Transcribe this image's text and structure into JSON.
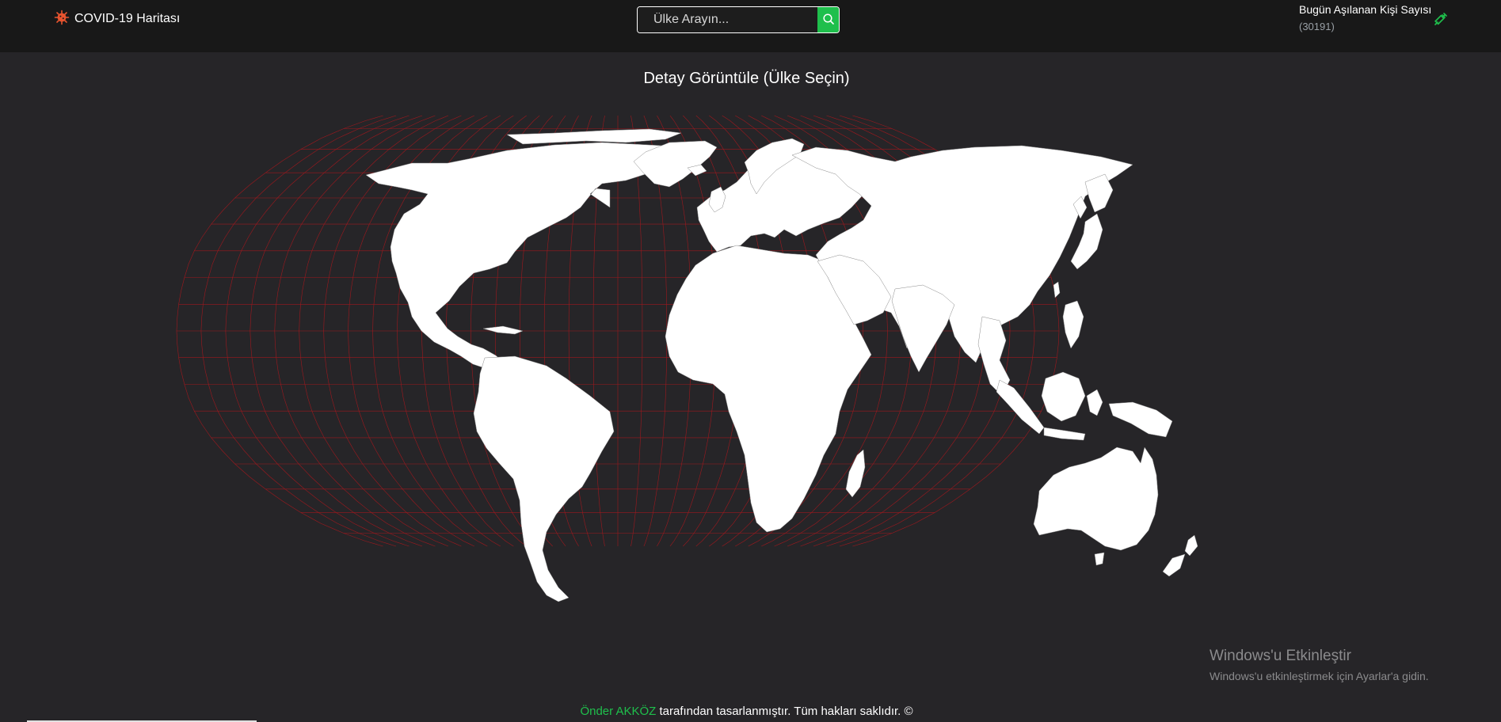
{
  "header": {
    "brand_label": "COVID-19 Haritası",
    "brand_icon": "virus-icon",
    "search_placeholder": "Ülke Arayın...",
    "search_icon": "search-icon",
    "vaccination_title": "Bugün Aşılanan Kişi Sayısı",
    "vaccination_count": "(30191)",
    "vaccination_icon": "syringe-icon"
  },
  "main": {
    "detail_title": "Detay Görüntüle (Ülke Seçin)"
  },
  "map": {
    "projection": "Robinson",
    "land_color": "#ffffff",
    "border_color": "#8a8a8a",
    "graticule_color": "#b3161c"
  },
  "watermark": {
    "title": "Windows'u Etkinleştir",
    "subtitle": "Windows'u etkinleştirmek için Ayarlar'a gidin."
  },
  "footer": {
    "author": "Önder AKKÖZ",
    "text": " tarafından tasarlanmıştır. Tüm hakları saklıdır. ©"
  },
  "colors": {
    "page_bg": "#262528",
    "navbar_bg": "#181818",
    "accent": "#1fbf4c",
    "brand_icon": "#e8542f"
  }
}
